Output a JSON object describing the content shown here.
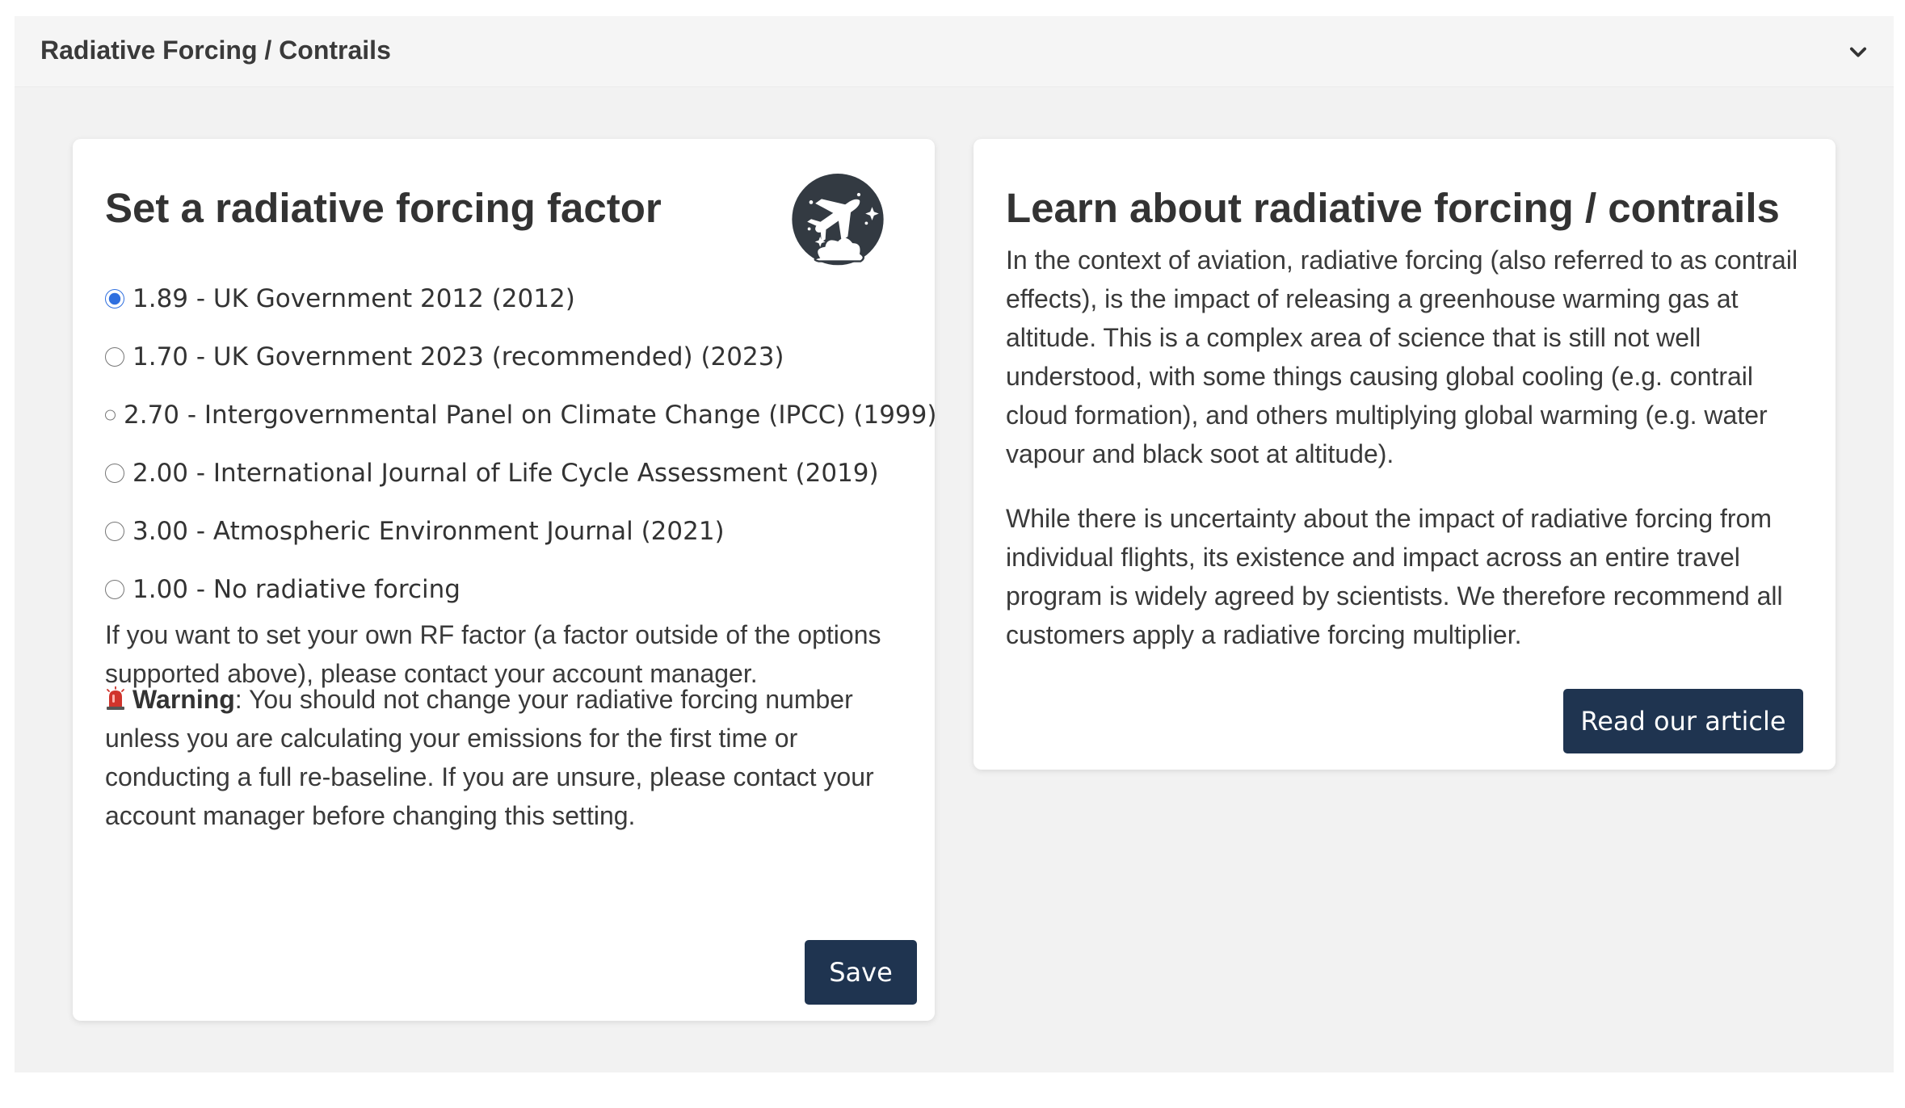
{
  "panel": {
    "title": "Radiative Forcing / Contrails",
    "toggle_icon": "chevron-down-icon"
  },
  "factor_card": {
    "heading": "Set a radiative forcing factor",
    "logo_icon": "airplane-globe-icon",
    "options": [
      {
        "label": "1.89 - UK Government 2012 (2012)",
        "selected": true
      },
      {
        "label": "1.70 - UK Government 2023 (recommended) (2023)",
        "selected": false
      },
      {
        "label": "2.70 - Intergovernmental Panel on Climate Change (IPCC) (1999)",
        "selected": false
      },
      {
        "label": "2.00 - International Journal of Life Cycle Assessment (2019)",
        "selected": false
      },
      {
        "label": "3.00 - Atmospheric Environment Journal (2021)",
        "selected": false
      },
      {
        "label": "1.00 - No radiative forcing",
        "selected": false
      }
    ],
    "custom_note": "If you want to set your own RF factor (a factor outside of the options supported above), please contact your account manager.",
    "warning_icon": "siren-icon",
    "warning_label": "Warning",
    "warning_text": ": You should not change your radiative forcing number unless you are calculating your emissions for the first time or conducting a full re-baseline. If you are unsure, please contact your account manager before changing this setting.",
    "save_label": "Save"
  },
  "learn_card": {
    "heading": "Learn about radiative forcing / contrails",
    "paragraph_1": "In the context of aviation, radiative forcing (also referred to as contrail effects), is the impact of releasing a greenhouse warming gas at altitude. This is a complex area of science that is still not well understood, with some things causing global cooling (e.g. contrail cloud formation), and others multiplying global warming (e.g. water vapour and black soot at altitude).",
    "paragraph_2": "While there is uncertainty about the impact of radiative forcing from individual flights, its existence and impact across an entire travel program is widely agreed by scientists. We therefore recommend all customers apply a radiative forcing multiplier.",
    "button_label": "Read our article"
  },
  "colors": {
    "button_bg": "#1f3450",
    "panel_bg": "#f2f2f2",
    "radio_accent": "#2f6fdf",
    "warning_red": "#d0342c"
  }
}
